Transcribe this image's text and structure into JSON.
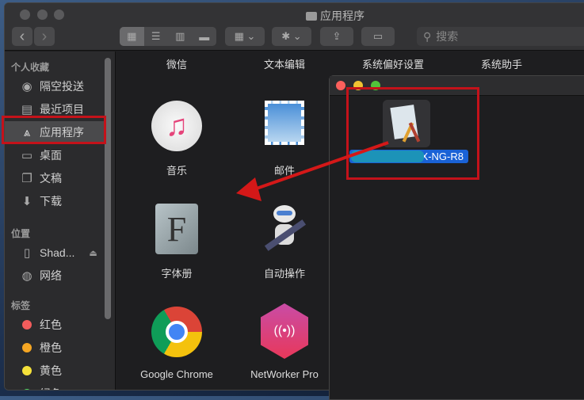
{
  "window": {
    "title": "应用程序"
  },
  "toolbar": {
    "back": "‹",
    "forward": "›",
    "search_placeholder": "搜索"
  },
  "sidebar": {
    "favorites_header": "个人收藏",
    "favorites": [
      {
        "label": "隔空投送",
        "icon": "airdrop-icon"
      },
      {
        "label": "最近项目",
        "icon": "recents-icon"
      },
      {
        "label": "应用程序",
        "icon": "applications-icon",
        "selected": true
      },
      {
        "label": "桌面",
        "icon": "desktop-icon"
      },
      {
        "label": "文稿",
        "icon": "documents-icon"
      },
      {
        "label": "下载",
        "icon": "downloads-icon"
      }
    ],
    "locations_header": "位置",
    "locations": [
      {
        "label": "Shad...",
        "icon": "disk-icon"
      },
      {
        "label": "网络",
        "icon": "network-icon"
      }
    ],
    "tags_header": "标签",
    "tags": [
      {
        "label": "红色",
        "color": "#f25c5c"
      },
      {
        "label": "橙色",
        "color": "#f5a623"
      },
      {
        "label": "黄色",
        "color": "#f5e13a"
      },
      {
        "label": "绿色",
        "color": "#4cd964"
      }
    ]
  },
  "main": {
    "top_labels": [
      "微信",
      "文本编辑",
      "系统偏好设置",
      "系统助手"
    ],
    "apps": [
      {
        "label": "音乐"
      },
      {
        "label": "邮件"
      },
      {
        "label": "字体册"
      },
      {
        "label": "自动操作"
      },
      {
        "label": "Google Chrome"
      },
      {
        "label": "NetWorker Pro"
      }
    ]
  },
  "second_window": {
    "file_label": "X-NG-R8"
  },
  "colors": {
    "annotation": "#c4121a",
    "selection": "#1a62d6"
  }
}
